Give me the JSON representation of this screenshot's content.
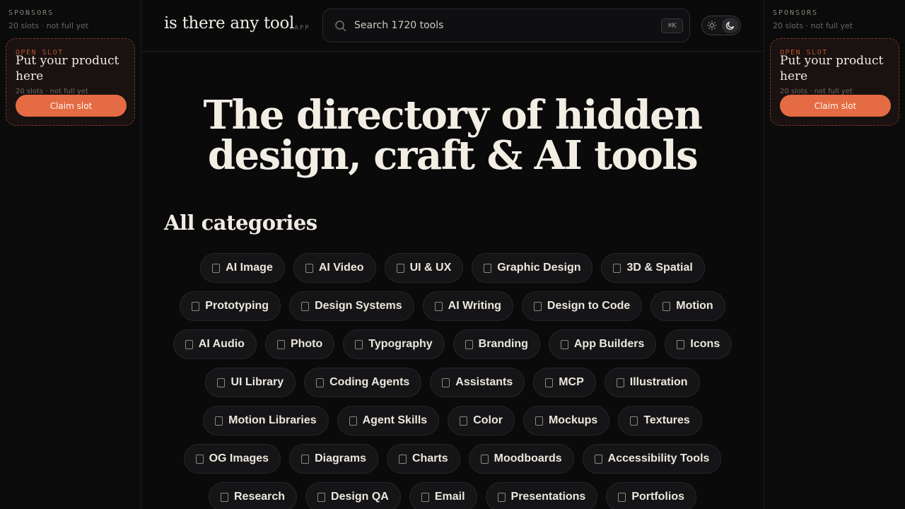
{
  "sponsors": {
    "title": "SPONSORS",
    "subtitle": "20 slots · not full yet",
    "slot": {
      "eyebrow": "OPEN SLOT",
      "headline": "Put your product here",
      "meta": "20 slots · not full yet",
      "button": "Claim slot"
    }
  },
  "header": {
    "logo": "is there any tool",
    "tld": ".APP",
    "search_placeholder": "Search 1720 tools",
    "shortcut": "⌘K"
  },
  "hero": {
    "line1": "The directory of hidden",
    "line2": "design, craft & AI tools"
  },
  "categories": {
    "title": "All categories",
    "rows": [
      [
        "AI Image",
        "AI Video",
        "UI & UX",
        "Graphic Design",
        "3D & Spatial"
      ],
      [
        "Prototyping",
        "Design Systems",
        "AI Writing",
        "Design to Code",
        "Motion"
      ],
      [
        "AI Audio",
        "Photo",
        "Typography",
        "Branding",
        "App Builders",
        "Icons"
      ],
      [
        "UI Library",
        "Coding Agents",
        "Assistants",
        "MCP",
        "Illustration"
      ],
      [
        "Motion Libraries",
        "Agent Skills",
        "Color",
        "Mockups",
        "Textures"
      ],
      [
        "OG Images",
        "Diagrams",
        "Charts",
        "Moodboards",
        "Accessibility Tools"
      ],
      [
        "Research",
        "Design QA",
        "Email",
        "Presentations",
        "Portfolios"
      ]
    ]
  },
  "colors": {
    "accent": "#e46b43",
    "background": "#0a0a0b",
    "chip_bg": "#151517"
  }
}
